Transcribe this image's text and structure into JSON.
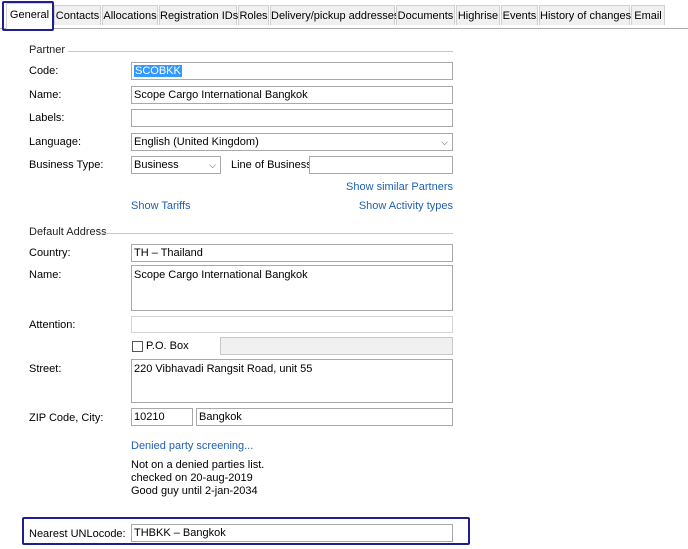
{
  "tabs": [
    "General",
    "Contacts",
    "Allocations",
    "Registration IDs",
    "Roles",
    "Delivery/pickup addresses",
    "Documents",
    "Highrise",
    "Events",
    "History of changes",
    "Email"
  ],
  "partner": {
    "section_label": "Partner",
    "code_label": "Code:",
    "code_value": "SCOBKK",
    "name_label": "Name:",
    "name_value": "Scope Cargo International Bangkok",
    "labels_label": "Labels:",
    "labels_value": "",
    "language_label": "Language:",
    "language_value": "English (United Kingdom)",
    "business_type_label": "Business Type:",
    "business_type_value": "Business",
    "line_of_business_label": "Line of Business:",
    "line_of_business_value": "",
    "show_similar_link": "Show similar Partners",
    "show_tariffs_link": "Show Tariffs",
    "show_activity_link": "Show Activity types"
  },
  "address": {
    "section_label": "Default Address",
    "country_label": "Country:",
    "country_value": "TH – Thailand",
    "name_label": "Name:",
    "name_value": "Scope Cargo International Bangkok",
    "attention_label": "Attention:",
    "attention_value": "",
    "pobox_label": "P.O. Box",
    "pobox_value": "",
    "street_label": "Street:",
    "street_value": "220 Vibhavadi Rangsit Road, unit 55",
    "zip_city_label": "ZIP Code, City:",
    "zip_value": "10210",
    "city_value": "Bangkok"
  },
  "screening": {
    "link": "Denied party screening...",
    "status_line1": "Not on a denied parties list.",
    "status_line2": "checked on 20-aug-2019",
    "status_line3": "Good guy until 2-jan-2034"
  },
  "unlocode": {
    "label": "Nearest UNLocode:",
    "value": "THBKK – Bangkok"
  },
  "icons": {
    "dropdown": "chevron-down-icon"
  },
  "colors": {
    "link": "#1f5fb4",
    "highlight_box": "#1e1e8e",
    "selection": "#3399ff"
  }
}
